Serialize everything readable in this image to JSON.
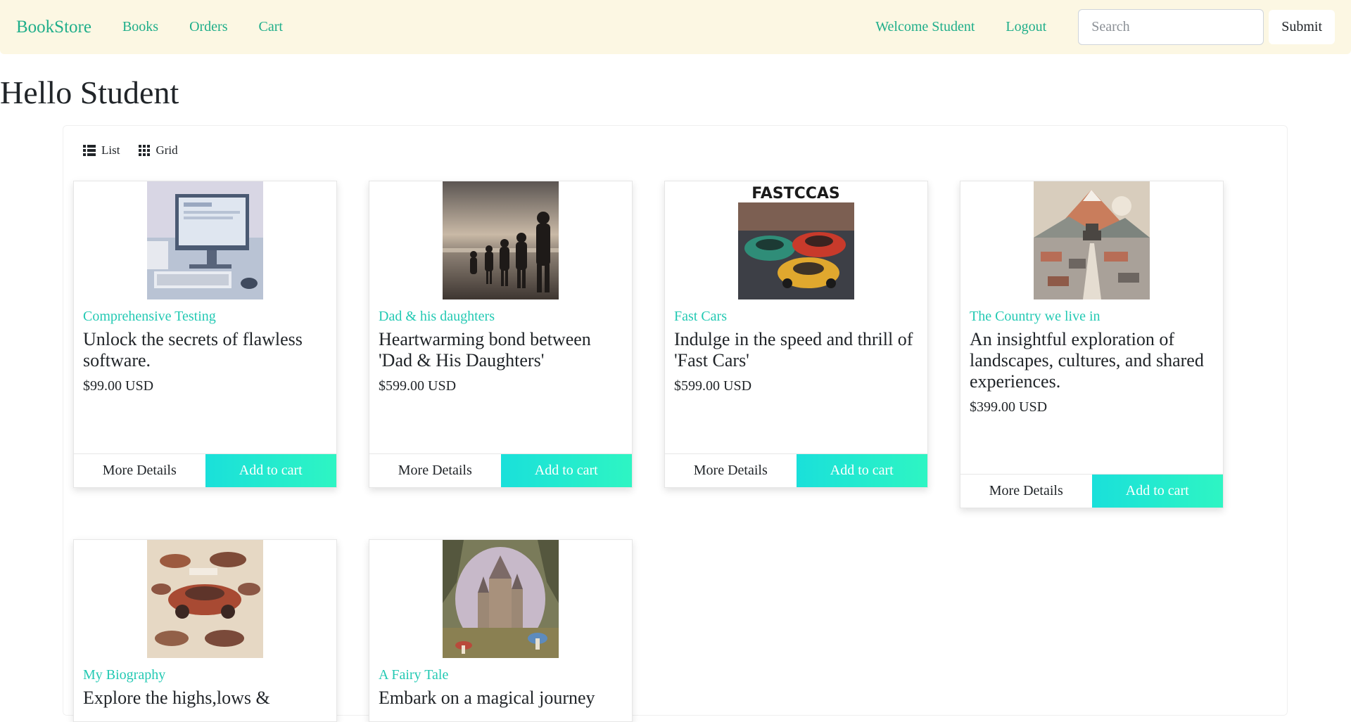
{
  "nav": {
    "brand": "BookStore",
    "links": [
      "Books",
      "Orders",
      "Cart"
    ],
    "welcome": "Welcome Student",
    "logout": "Logout",
    "search_placeholder": "Search",
    "submit": "Submit"
  },
  "page": {
    "title": "Hello Student"
  },
  "view_toggle": {
    "list": "List",
    "grid": "Grid"
  },
  "cards": [
    {
      "category": "Comprehensive Testing",
      "description": "Unlock the secrets of flawless software.",
      "price": "$99.00 USD",
      "more": "More Details",
      "add": "Add to cart",
      "image": "computer-desk-image"
    },
    {
      "category": "Dad & his daughters",
      "description": "Heartwarming bond between 'Dad & His Daughters'",
      "price": "$599.00 USD",
      "more": "More Details",
      "add": "Add to cart",
      "image": "beach-family-image"
    },
    {
      "category": "Fast Cars",
      "description": "Indulge in the speed and thrill of 'Fast Cars'",
      "price": "$599.00 USD",
      "more": "More Details",
      "add": "Add to cart",
      "image": "race-cars-image"
    },
    {
      "category": "The Country we live in",
      "description": "An insightful exploration of landscapes, cultures, and shared experiences.",
      "price": "$399.00 USD",
      "more": "More Details",
      "add": "Add to cart",
      "image": "mountain-town-image"
    },
    {
      "category": "My Biography",
      "description": "Explore the highs,lows &",
      "price": "",
      "more": "",
      "add": "",
      "image": "vintage-cars-sketch-image"
    },
    {
      "category": "A Fairy Tale",
      "description": "Embark on a magical journey",
      "price": "",
      "more": "",
      "add": "",
      "image": "fairy-castle-image"
    }
  ],
  "colors": {
    "accent": "#1fae8a",
    "category": "#23c9b3",
    "navbar_bg": "#fcf7e3",
    "cart_gradient_start": "#1ae0da",
    "cart_gradient_end": "#2ef5c3"
  }
}
